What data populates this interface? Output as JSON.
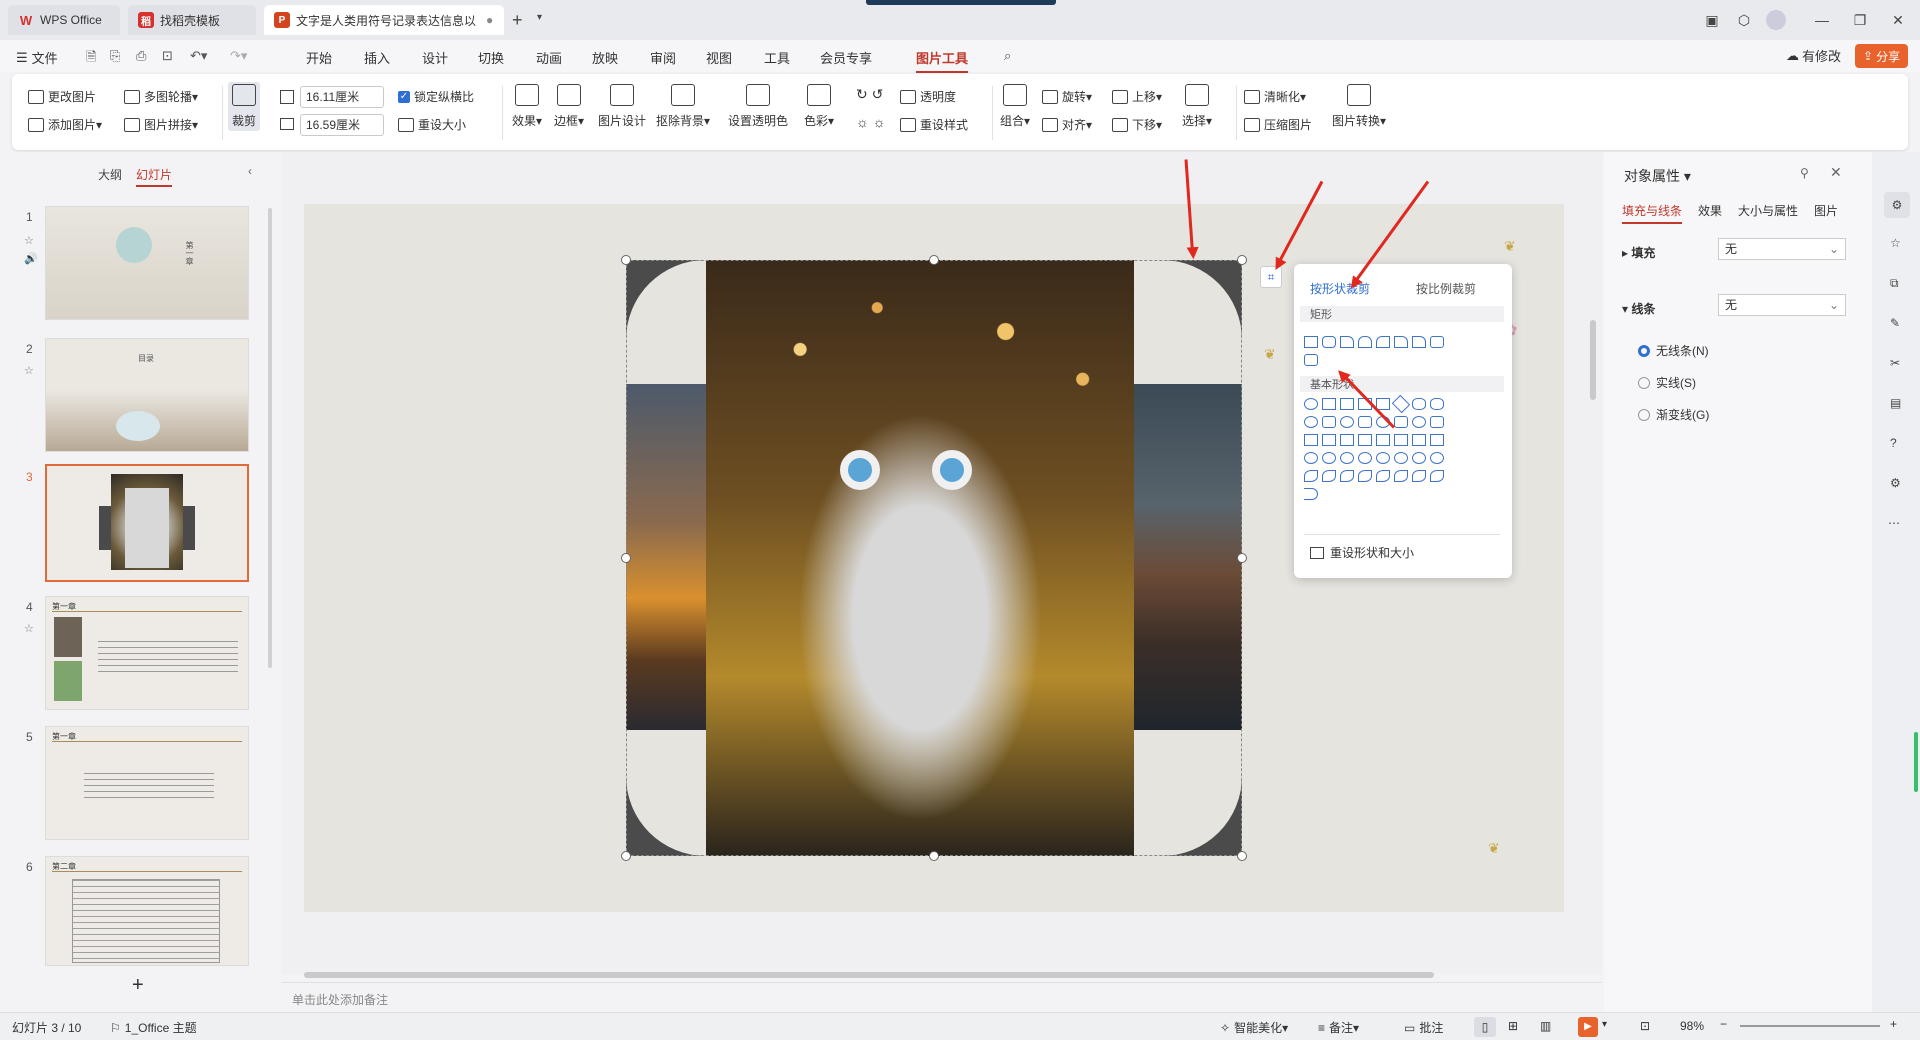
{
  "titlebar": {
    "tabs": [
      {
        "label": "WPS Office",
        "icon": "W",
        "color": "#d6312c"
      },
      {
        "label": "找稻壳模板",
        "icon": "稻",
        "color": "#d6312c"
      },
      {
        "label": "文字是人类用符号记录表达信息以",
        "icon": "P",
        "color": "#d1441f"
      }
    ],
    "new_tab": "+"
  },
  "menubar": {
    "file": "文件",
    "items": [
      "开始",
      "插入",
      "设计",
      "切换",
      "动画",
      "放映",
      "审阅",
      "视图",
      "工具",
      "会员专享",
      "图片工具"
    ],
    "active": "图片工具",
    "has_changes": "有修改",
    "share": "分享"
  },
  "ribbon": {
    "change_picture": "更改图片",
    "add_picture": "添加图片",
    "multi_carousel": "多图轮播",
    "picture_collage": "图片拼接",
    "crop": "裁剪",
    "width": "16.11厘米",
    "height": "16.59厘米",
    "lock_ratio": "锁定纵横比",
    "reset_size": "重设大小",
    "effects": "效果",
    "border": "边框",
    "picture_design": "图片设计",
    "remove_background": "抠除背景",
    "set_transparent": "设置透明色",
    "color": "色彩",
    "transparency": "透明度",
    "reset_style": "重设样式",
    "group": "组合",
    "rotate": "旋转",
    "align": "对齐",
    "bring_forward": "上移",
    "send_backward": "下移",
    "select": "选择",
    "sharpen": "清晰化",
    "compress": "压缩图片",
    "convert": "图片转换"
  },
  "leftpanel": {
    "tab_outline": "大纲",
    "tab_slides": "幻灯片",
    "slides": [
      {
        "num": "1",
        "title": "第一章"
      },
      {
        "num": "2",
        "title": "目录"
      },
      {
        "num": "3",
        "title": ""
      },
      {
        "num": "4",
        "title": "第一章"
      },
      {
        "num": "5",
        "title": "第一章"
      },
      {
        "num": "6",
        "title": "第二章"
      }
    ],
    "add": "+"
  },
  "popup": {
    "tab_shape": "按形状裁剪",
    "tab_ratio": "按比例裁剪",
    "section_rect": "矩形",
    "section_basic": "基本形状",
    "reset": "重设形状和大小"
  },
  "rightpanel": {
    "title": "对象属性",
    "tabs": [
      "填充与线条",
      "效果",
      "大小与属性",
      "图片"
    ],
    "fill_label": "填充",
    "fill_value": "无",
    "line_label": "线条",
    "line_value": "无",
    "options": [
      "无线条(N)",
      "实线(S)",
      "渐变线(G)"
    ]
  },
  "notes_placeholder": "单击此处添加备注",
  "statusbar": {
    "slide_info": "幻灯片 3 / 10",
    "theme": "1_Office 主题",
    "beautify": "智能美化",
    "notes": "备注",
    "comments": "批注",
    "zoom": "98%"
  },
  "colors": {
    "accent": "#c0392b",
    "share": "#e8622c",
    "selection": "#e06a3a"
  }
}
